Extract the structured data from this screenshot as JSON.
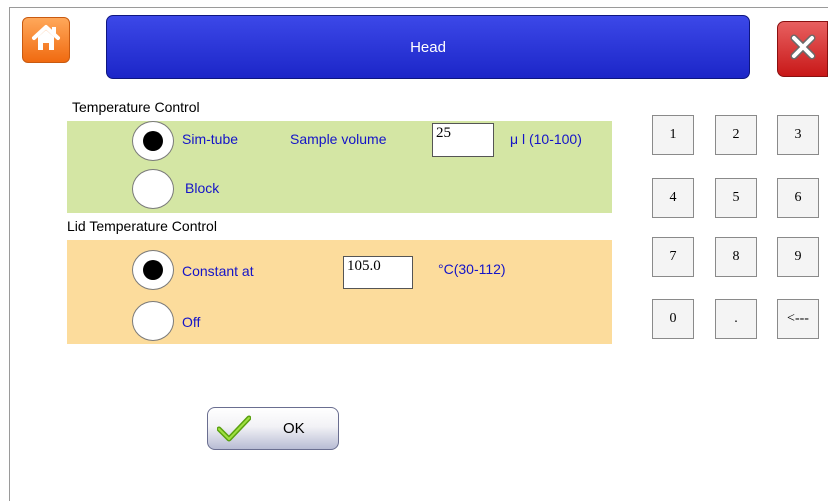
{
  "header": {
    "title": "Head",
    "home_icon": "home-icon",
    "close_icon": "close-icon"
  },
  "temperature_control": {
    "label": "Temperature Control",
    "options": [
      {
        "label": "Sim-tube",
        "selected": true
      },
      {
        "label": "Block",
        "selected": false
      }
    ],
    "sample_volume_label": "Sample volume",
    "sample_volume_value": "25",
    "sample_volume_unit": "μ l (10-100)"
  },
  "lid_temperature_control": {
    "label": "Lid Temperature Control",
    "options": [
      {
        "label": "Constant at",
        "selected": true
      },
      {
        "label": "Off",
        "selected": false
      }
    ],
    "constant_value": "105.0",
    "unit": "°C(30-112)"
  },
  "keypad": {
    "keys": [
      "1",
      "2",
      "3",
      "4",
      "5",
      "6",
      "7",
      "8",
      "9",
      "0",
      ".",
      "<---"
    ]
  },
  "ok_button": {
    "label": "OK"
  },
  "colors": {
    "title_bar": "#2030d8",
    "temp_panel": "#d4e6a4",
    "lid_panel": "#fcdc9c",
    "label_blue": "#1414c8"
  }
}
